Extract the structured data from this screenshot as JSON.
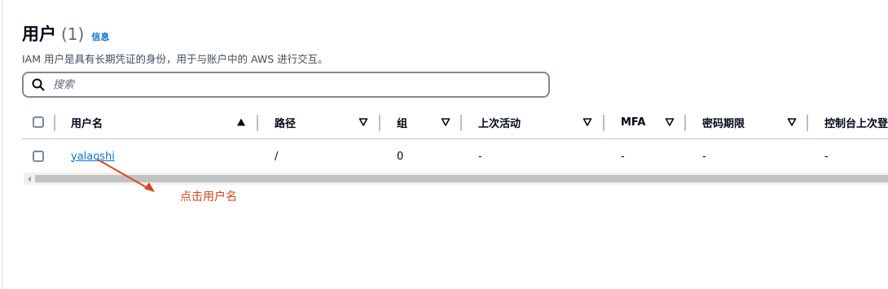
{
  "header": {
    "title": "用户",
    "count": "(1)",
    "info_link": "信息"
  },
  "description": "IAM 用户是具有长期凭证的身份，用于与账户中的 AWS 进行交互。",
  "search": {
    "placeholder": "搜索",
    "value": ""
  },
  "table": {
    "columns": [
      {
        "key": "username",
        "label": "用户名",
        "sort": "ascending"
      },
      {
        "key": "path",
        "label": "路径",
        "sort": "none"
      },
      {
        "key": "group",
        "label": "组",
        "sort": "none"
      },
      {
        "key": "last_activity",
        "label": "上次活动",
        "sort": "none"
      },
      {
        "key": "mfa",
        "label": "MFA",
        "sort": "none"
      },
      {
        "key": "password_age",
        "label": "密码期限",
        "sort": "none"
      },
      {
        "key": "console_last_signin",
        "label": "控制台上次登",
        "sort": "none"
      }
    ],
    "rows": [
      {
        "username": "yalaoshi",
        "path": "/",
        "group": "0",
        "last_activity": "-",
        "mfa": "-",
        "password_age": "-",
        "console_last_signin": "-"
      }
    ]
  },
  "annotation": {
    "text": "点击用户名",
    "color": "#d4461d"
  },
  "colors": {
    "link": "#0972d3",
    "text": "#000716",
    "border": "#7d8998"
  }
}
